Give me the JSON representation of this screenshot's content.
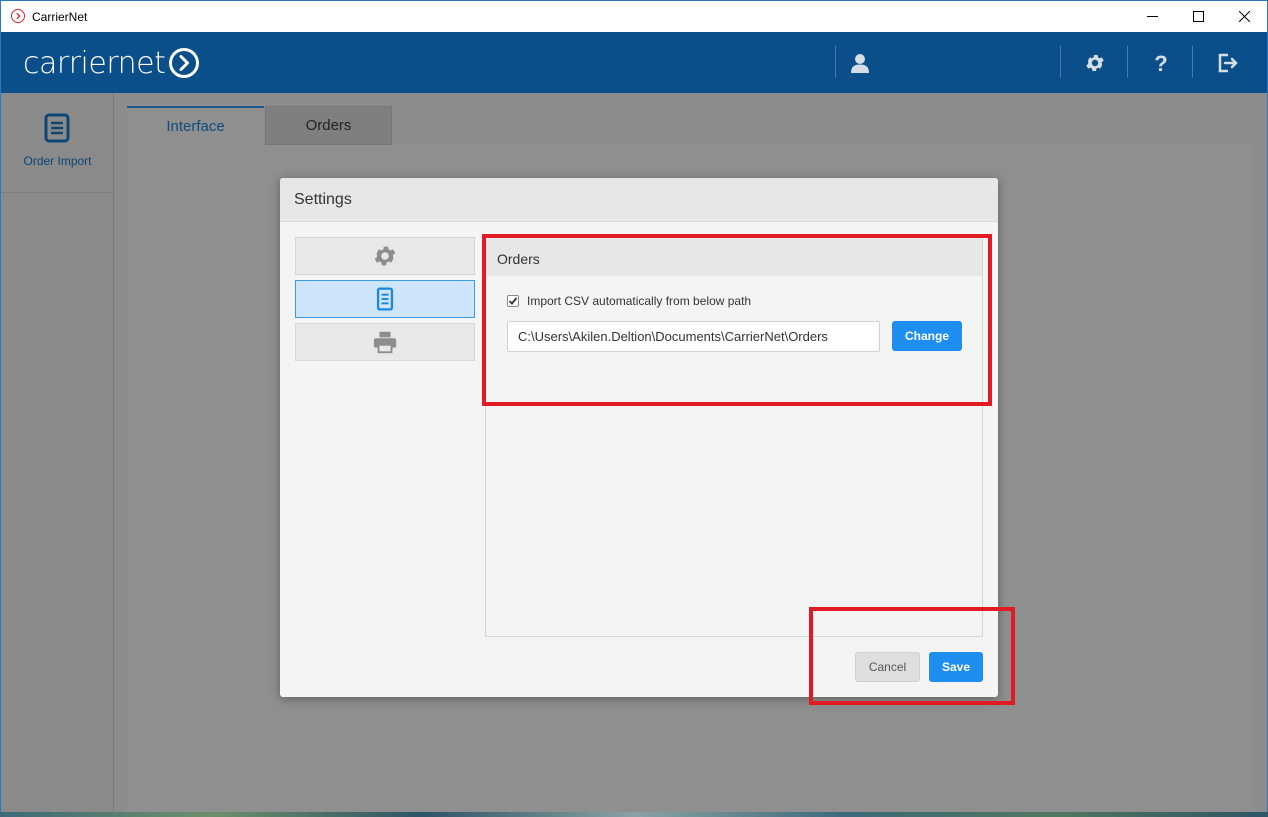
{
  "window": {
    "title": "CarrierNet"
  },
  "header": {
    "logo_text": "carriernet"
  },
  "sidebar": {
    "items": [
      {
        "label": "Order Import",
        "icon": "document-icon"
      }
    ]
  },
  "tabs": [
    {
      "label": "Interface",
      "active": true
    },
    {
      "label": "Orders",
      "active": false
    }
  ],
  "modal": {
    "title": "Settings",
    "side_buttons": [
      {
        "icon": "gear-icon",
        "active": false
      },
      {
        "icon": "document-icon",
        "active": true
      },
      {
        "icon": "printer-icon",
        "active": false
      }
    ],
    "orders_section": {
      "title": "Orders",
      "checkbox_label": "Import CSV automatically from below path",
      "checkbox_checked": true,
      "path_value": "C:\\Users\\Akilen.Deltion\\Documents\\CarrierNet\\Orders",
      "change_label": "Change"
    },
    "cancel_label": "Cancel",
    "save_label": "Save"
  },
  "colors": {
    "header_bg": "#0b4f8a",
    "accent_blue": "#1e8ff0",
    "highlight_red": "#e01b24"
  }
}
